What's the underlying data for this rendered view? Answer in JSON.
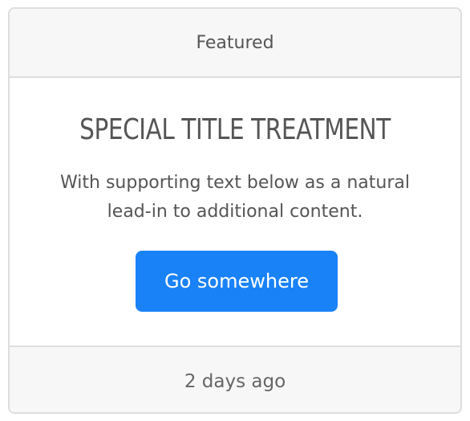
{
  "card": {
    "header": "Featured",
    "title": "SPECIAL TITLE TREATMENT",
    "text": "With supporting text below as a natural lead-in to additional content.",
    "button_label": "Go somewhere",
    "footer": "2 days ago"
  },
  "colors": {
    "button_bg": "#1a82f7",
    "text": "#555555",
    "header_footer_bg": "#f7f7f7",
    "border": "#dedede"
  }
}
